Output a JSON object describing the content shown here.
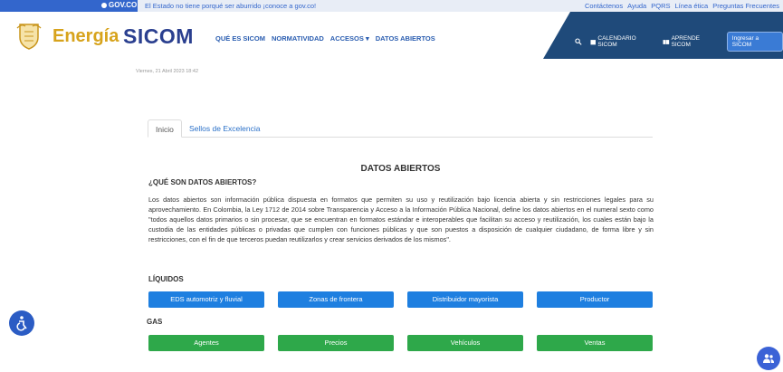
{
  "govbar": {
    "logo": "GOV.CO",
    "message": "El Estado no tiene porqué ser aburrido ¡conoce a gov.co!",
    "links": [
      "Contáctenos",
      "Ayuda",
      "PQRS",
      "Línea ética",
      "Preguntas Frecuentes"
    ]
  },
  "header": {
    "brand_energia": "Energía",
    "brand_sicom": "SICOM",
    "nav": [
      "QUÉ ES SICOM",
      "NORMATIVIDAD",
      "ACCESOS ▾",
      "DATOS ABIERTOS"
    ],
    "calendar": "CALENDARIO SICOM",
    "learn": "APRENDE SICOM",
    "login": "Ingresar a SICOM"
  },
  "date": "Viernes, 21 Abril 2023 18:42",
  "tabs": [
    "Inicio",
    "Sellos de Excelencia"
  ],
  "content": {
    "title": "DATOS ABIERTOS",
    "question": "¿QUÉ SON DATOS ABIERTOS?",
    "paragraph": "Los datos abiertos son información pública dispuesta en formatos que permiten su uso y reutilización bajo licencia abierta y sin restricciones legales para su aprovechamiento. En Colombia, la Ley 1712 de 2014 sobre Transparencia y Acceso a la Información Pública Nacional, define los datos abiertos en el numeral sexto como \"todos aquellos datos primarios o sin procesar, que se encuentran en formatos estándar e interoperables que facilitan su acceso y reutilización, los cuales están bajo la custodia de las entidades públicas o privadas que cumplen con funciones públicas y que son puestos a disposición de cualquier ciudadano, de forma libre y sin restricciones, con el fin de que terceros puedan reutilizarlos y crear servicios derivados de los mismos\"."
  },
  "liquidos": {
    "heading": "LÍQUIDOS",
    "buttons": [
      "EDS automotriz y fluvial",
      "Zonas de frontera",
      "Distribuidor mayorista",
      "Productor"
    ]
  },
  "gas": {
    "heading": "GAS",
    "buttons": [
      "Agentes",
      "Precios",
      "Vehículos",
      "Ventas"
    ]
  }
}
